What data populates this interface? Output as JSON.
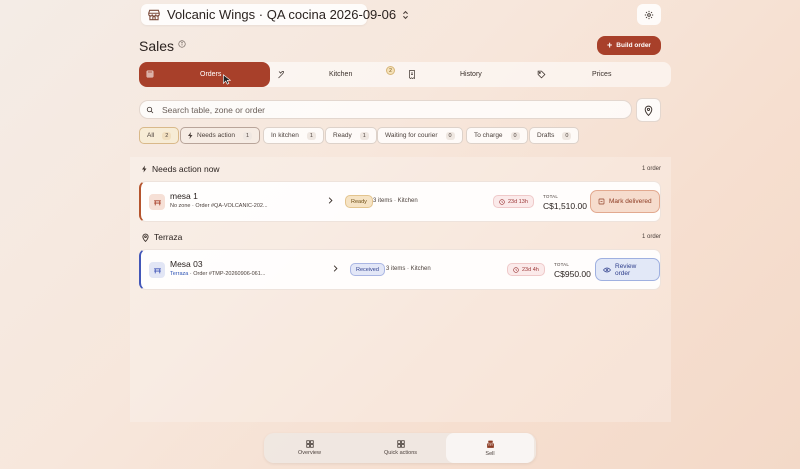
{
  "header": {
    "venue_title": "Volcanic Wings · QA cocina 2026-09-06",
    "store_icon": "store-icon",
    "settings_icon": "gear-icon"
  },
  "page": {
    "title": "Sales",
    "build_order_label": "Build order"
  },
  "tabs": [
    {
      "label": "Orders",
      "icon": "grid-icon",
      "active": true
    },
    {
      "label": "Kitchen",
      "icon": "chef-icon",
      "badge": "2"
    },
    {
      "label": "History",
      "icon": "receipt-icon"
    },
    {
      "label": "Prices",
      "icon": "tag-icon"
    }
  ],
  "search": {
    "placeholder": "Search table, zone or order"
  },
  "filters": [
    {
      "label": "All",
      "count": "2"
    },
    {
      "label": "Needs action",
      "count": "1"
    },
    {
      "label": "In kitchen",
      "count": "1"
    },
    {
      "label": "Ready",
      "count": "1"
    },
    {
      "label": "Waiting for courier",
      "count": "0"
    },
    {
      "label": "To charge",
      "count": "0"
    },
    {
      "label": "Drafts",
      "count": "0"
    }
  ],
  "sections": [
    {
      "title": "Needs action now",
      "count_label": "1 order",
      "order": {
        "name": "mesa 1",
        "zone": "No zone",
        "order_ref": "Order #QA-VOLCANIC-202...",
        "status": "Ready",
        "items": "3 items · Kitchen",
        "elapsed": "23d 13h",
        "total_label": "TOTAL",
        "total": "C$1,510.00",
        "action": "Mark delivered"
      }
    },
    {
      "title": "Terraza",
      "count_label": "1 order",
      "order": {
        "name": "Mesa 03",
        "zone": "Terraza",
        "order_ref": "Order #TMP-20260906-061...",
        "status": "Received",
        "items": "3 items · Kitchen",
        "elapsed": "23d 4h",
        "total_label": "TOTAL",
        "total": "C$950.00",
        "action": "Review order"
      }
    }
  ],
  "bottom_nav": [
    {
      "label": "Overview",
      "icon": "dashboard-icon"
    },
    {
      "label": "Quick actions",
      "icon": "apps-icon"
    },
    {
      "label": "Sell",
      "icon": "register-icon",
      "active": true
    }
  ],
  "colors": {
    "accent": "#a8402a",
    "ready_bg": "#f6e3c4",
    "received_bg": "#e3e7f7",
    "review_btn_bg": "#e2e8f7"
  }
}
